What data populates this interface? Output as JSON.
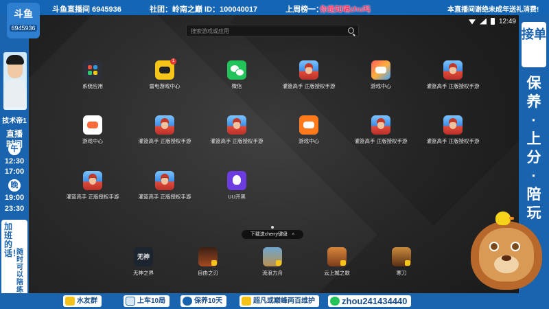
{
  "top_bar": {
    "logo_text": "斗鱼",
    "room_id_badge": "6945936",
    "room_label": "斗鱼直播间 6945936",
    "guild_label": "社团：岭南之巅 ID：100040017",
    "rank_label": "上周榜一：",
    "rank_name": "你是知嗝zhu吗",
    "notice": "本直播间谢绝未成年送礼消费!"
  },
  "left_panel": {
    "streamer_name": "技术帝1",
    "live_time_title": "直播时间",
    "noon_label": "午",
    "noon_start": "12:30",
    "noon_end": "17:00",
    "night_label": "晚",
    "night_start": "19:00",
    "night_end": "23:30",
    "overtime_text": "加班的话！",
    "anytime_text": "随时可以陪练"
  },
  "right_panel": {
    "order_label": "接单",
    "service_text": "保养·上分·陪玩"
  },
  "phone": {
    "status_time": "12:49",
    "search_placeholder": "搜索游戏或应用",
    "apps": [
      {
        "label": "系统应用",
        "icon": "system-apps-icon"
      },
      {
        "label": "雷电游戏中心",
        "icon": "thunder-game-center-icon",
        "badge": "1"
      },
      {
        "label": "微信",
        "icon": "wechat-icon"
      },
      {
        "label": "灌篮高手 正版授权手游",
        "icon": "slam-dunk-icon"
      },
      {
        "label": "游戏中心",
        "icon": "game-center-icon"
      },
      {
        "label": "灌篮高手 正版授权手游",
        "icon": "slam-dunk-icon"
      },
      {
        "label": "游戏中心",
        "icon": "game-center-icon"
      },
      {
        "label": "灌篮高手 正版授权手游",
        "icon": "slam-dunk-icon"
      },
      {
        "label": "灌篮高手 正版授权手游",
        "icon": "slam-dunk-icon"
      },
      {
        "label": "游戏中心",
        "icon": "game-center-icon"
      },
      {
        "label": "灌篮高手 正版授权手游",
        "icon": "slam-dunk-icon"
      },
      {
        "label": "灌篮高手 正版授权手游",
        "icon": "slam-dunk-icon"
      },
      {
        "label": "灌篮高手 正版授权手游",
        "icon": "slam-dunk-icon"
      },
      {
        "label": "灌篮高手 正版授权手游",
        "icon": "slam-dunk-icon"
      },
      {
        "label": "UU开黑",
        "icon": "uu-voice-icon"
      }
    ],
    "dock_apps": [
      {
        "label": "无神之界",
        "icon_text": "无神"
      },
      {
        "label": "自由之刃",
        "icon_text": ""
      },
      {
        "label": "流浪方舟",
        "icon_text": ""
      },
      {
        "label": "云上城之歌",
        "icon_text": ""
      },
      {
        "label": "寒刀",
        "icon_text": ""
      }
    ],
    "toast_text": "下载送cherry键盘",
    "toast_close": "×"
  },
  "bottom_bar": {
    "qq_group": "水友群",
    "up_car": "上车10局",
    "keep_rank": "保养10天",
    "soar": "超凡或巅峰两百维护",
    "wechat_id": "zhou241434440"
  },
  "colors": {
    "frame_blue": "#1a63ae",
    "rank_pink": "#ff3c6a",
    "screen_dark": "#262626"
  }
}
